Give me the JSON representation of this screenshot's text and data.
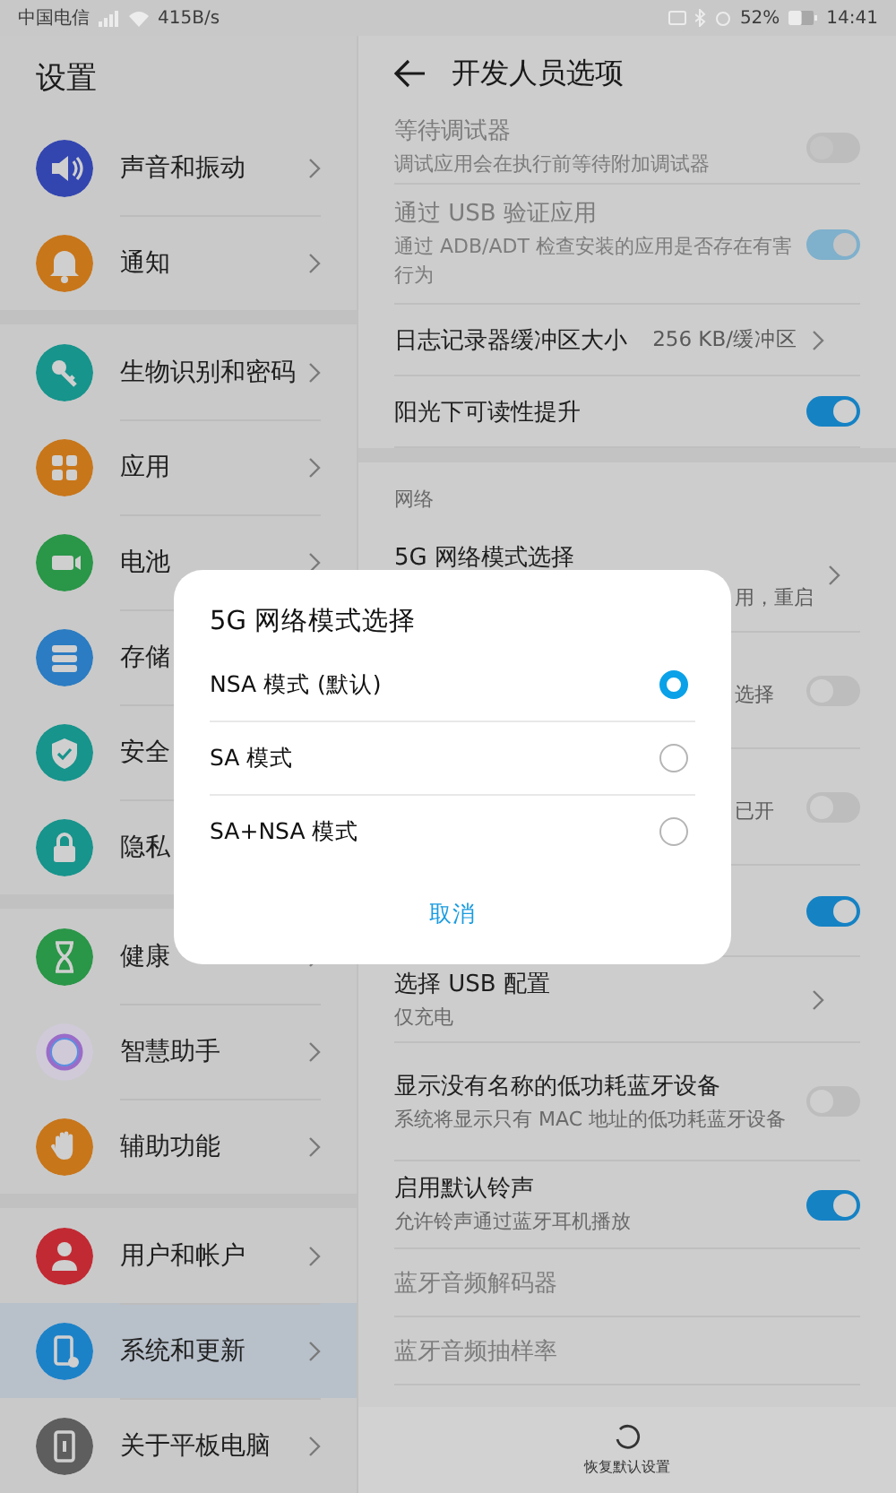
{
  "status_bar": {
    "carrier": "中国电信",
    "speed": "415B/s",
    "battery": "52%",
    "time": "14:41"
  },
  "sidebar": {
    "title": "设置",
    "groups": [
      {
        "items": [
          {
            "label": "声音和振动",
            "kind": "speaker",
            "color": "#3346b0",
            "selected": false
          },
          {
            "label": "通知",
            "kind": "bell",
            "color": "#c8761a",
            "selected": false
          }
        ]
      },
      {
        "items": [
          {
            "label": "生物识别和密码",
            "kind": "key",
            "color": "#17948c",
            "selected": false
          },
          {
            "label": "应用",
            "kind": "grid",
            "color": "#c8761a",
            "selected": false
          },
          {
            "label": "电池",
            "kind": "battery",
            "color": "#2a9648",
            "selected": false
          },
          {
            "label": "存储",
            "kind": "storage",
            "color": "#2b7cc2",
            "selected": false,
            "chevron": false
          },
          {
            "label": "安全",
            "kind": "shield",
            "color": "#17948c",
            "selected": false,
            "chevron": false
          },
          {
            "label": "隐私",
            "kind": "lock",
            "color": "#17948c",
            "selected": false,
            "chevron": false
          }
        ]
      },
      {
        "items": [
          {
            "label": "健康",
            "kind": "hourglass",
            "color": "#2a9648",
            "selected": false
          },
          {
            "label": "智慧助手",
            "kind": "ring",
            "color": "#9a6cc8",
            "selected": false
          },
          {
            "label": "辅助功能",
            "kind": "hand",
            "color": "#c8761a",
            "selected": false
          }
        ]
      },
      {
        "items": [
          {
            "label": "用户和帐户",
            "kind": "user",
            "color": "#c22a33",
            "selected": false
          },
          {
            "label": "系统和更新",
            "kind": "phone",
            "color": "#1c82c8",
            "selected": true
          },
          {
            "label": "关于平板电脑",
            "kind": "tablet",
            "color": "#5e5e5e",
            "selected": false
          }
        ]
      }
    ]
  },
  "page": {
    "title": "开发人员选项",
    "items": [
      {
        "kind": "switch",
        "title": "等待调试器",
        "subtitle": "调试应用会在执行前等待附加调试器",
        "disabled": true,
        "on": false
      },
      {
        "kind": "switch",
        "title": "通过 USB 验证应用",
        "subtitle": "通过 ADB/ADT 检查安装的应用是否存在有害行为",
        "disabled": true,
        "on": true
      },
      {
        "kind": "value",
        "title": "日志记录器缓冲区大小",
        "value": "256 KB/缓冲区"
      },
      {
        "kind": "switch",
        "title": "阳光下可读性提升",
        "on": true,
        "disabled": false
      },
      {
        "kind": "section",
        "title": "网络"
      },
      {
        "kind": "link",
        "title": "5G 网络模式选择",
        "covered_text": "用，重启"
      },
      {
        "kind": "switch",
        "covered_text": "选择",
        "on": false,
        "disabled": false
      },
      {
        "kind": "switch",
        "covered_text": "已开",
        "on": false,
        "disabled": false
      },
      {
        "kind": "switch",
        "on": true,
        "disabled": false
      },
      {
        "kind": "link",
        "title": "选择 USB 配置",
        "subtitle": "仅充电"
      },
      {
        "kind": "switch",
        "title": "显示没有名称的低功耗蓝牙设备",
        "subtitle": "系统将显示只有 MAC 地址的低功耗蓝牙设备",
        "disabled": false,
        "on": false
      },
      {
        "kind": "switch",
        "title": "启用默认铃声",
        "subtitle": "允许铃声通过蓝牙耳机播放",
        "disabled": false,
        "on": true
      },
      {
        "kind": "plain",
        "title": "蓝牙音频解码器",
        "disabled": true
      },
      {
        "kind": "plain",
        "title": "蓝牙音频抽样率",
        "disabled": true
      }
    ]
  },
  "footer": {
    "label": "恢复默认设置"
  },
  "dialog": {
    "title": "5G 网络模式选择",
    "options": [
      {
        "label": "NSA 模式 (默认)",
        "selected": true
      },
      {
        "label": "SA 模式",
        "selected": false
      },
      {
        "label": "SA+NSA 模式",
        "selected": false
      }
    ],
    "cancel": "取消"
  }
}
